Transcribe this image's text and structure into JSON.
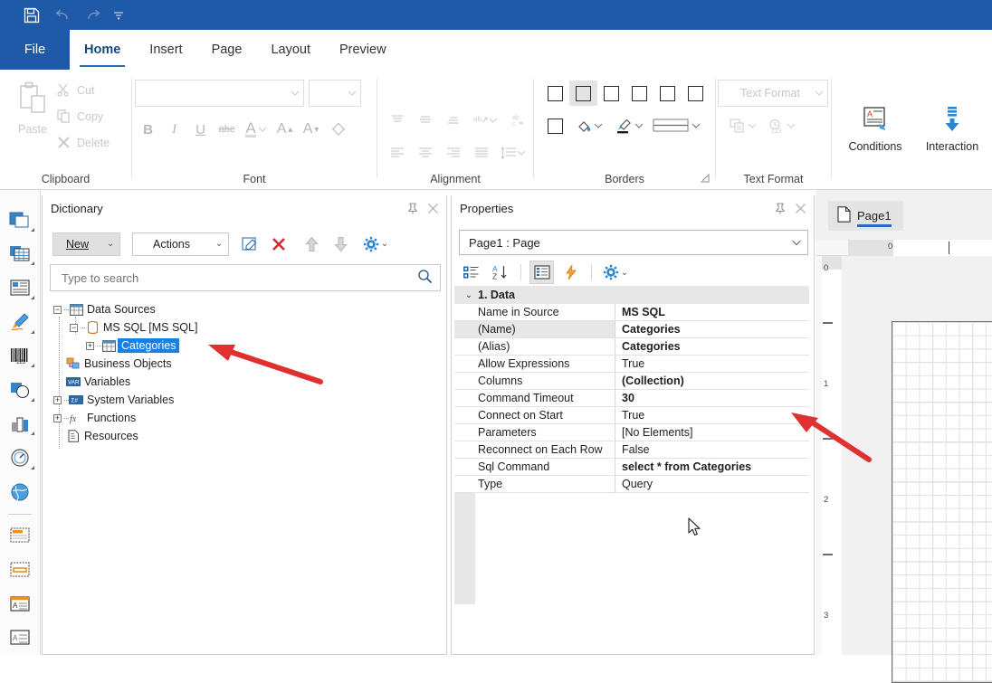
{
  "titlebar": {
    "buttons": [
      {
        "name": "save-icon",
        "label": "Save"
      },
      {
        "name": "undo-icon",
        "label": "Undo"
      },
      {
        "name": "redo-icon",
        "label": "Redo"
      },
      {
        "name": "customize-quick-access-icon",
        "label": "Customize Quick Access Toolbar"
      }
    ],
    "accent_color": "#1f5aa8"
  },
  "ribbon": {
    "file_tab": "File",
    "tabs": [
      {
        "label": "Home",
        "active": true
      },
      {
        "label": "Insert",
        "active": false
      },
      {
        "label": "Page",
        "active": false
      },
      {
        "label": "Layout",
        "active": false
      },
      {
        "label": "Preview",
        "active": false
      }
    ],
    "groups": {
      "clipboard": {
        "label": "Clipboard",
        "paste": "Paste",
        "cut": "Cut",
        "copy": "Copy",
        "delete": "Delete"
      },
      "font": {
        "label": "Font",
        "font_name_value": "",
        "font_size_value": "",
        "bold": "B",
        "italic": "I",
        "underline": "U",
        "strikeout": "abc",
        "font_color": "A",
        "grow_font": "A",
        "shrink_font": "A",
        "clear_format": "clear-format-icon"
      },
      "alignment": {
        "label": "Alignment"
      },
      "borders": {
        "label": "Borders"
      },
      "text_format": {
        "label": "Text Format",
        "combo_value": "Text Format"
      },
      "tools": {
        "conditions": "Conditions",
        "interaction": "Interaction"
      }
    }
  },
  "dictionary": {
    "title": "Dictionary",
    "toolbar": {
      "new": "New",
      "actions": "Actions",
      "edit": "edit-icon",
      "delete": "delete-icon",
      "move_up": "arrow-up-icon",
      "move_down": "arrow-down-icon",
      "settings": "gear-icon"
    },
    "search_placeholder": "Type to search",
    "search_value": "",
    "tree": [
      {
        "label": "Data Sources",
        "icon": "table-icon",
        "expanded": true,
        "level": 0
      },
      {
        "label": "MS SQL [MS SQL]",
        "icon": "database-icon",
        "expanded": true,
        "level": 1
      },
      {
        "label": "Categories",
        "icon": "table-icon",
        "expanded": false,
        "level": 2,
        "selected": true
      },
      {
        "label": "Business Objects",
        "icon": "business-objects-icon",
        "level": 0
      },
      {
        "label": "Variables",
        "icon": "variable-icon",
        "level": 0
      },
      {
        "label": "System Variables",
        "icon": "system-variable-icon",
        "expandable": true,
        "level": 0
      },
      {
        "label": "Functions",
        "icon": "function-icon",
        "expandable": true,
        "level": 0
      },
      {
        "label": "Resources",
        "icon": "resource-icon",
        "level": 0
      }
    ]
  },
  "properties": {
    "title": "Properties",
    "object_selector_value": "Page1 : Page",
    "toolbar": {
      "categorized": "categorized-view-icon",
      "alphabetical": "sort-alphabetical-icon",
      "properties": "properties-view-icon",
      "events": "events-lightning-icon",
      "settings": "gear-icon"
    },
    "category": "1. Data",
    "rows": [
      {
        "name": "Name in Source",
        "value": "MS SQL",
        "bold": true,
        "highlight": false
      },
      {
        "name": "(Name)",
        "value": "Categories",
        "bold": true,
        "highlight": true
      },
      {
        "name": "(Alias)",
        "value": "Categories",
        "bold": true,
        "highlight": false
      },
      {
        "name": "Allow Expressions",
        "value": "True",
        "bold": false,
        "highlight": false
      },
      {
        "name": "Columns",
        "value": "(Collection)",
        "bold": true,
        "highlight": false
      },
      {
        "name": "Command Timeout",
        "value": "30",
        "bold": true,
        "highlight": false
      },
      {
        "name": "Connect on Start",
        "value": "True",
        "bold": false,
        "highlight": false
      },
      {
        "name": "Parameters",
        "value": "[No Elements]",
        "bold": false,
        "highlight": false
      },
      {
        "name": "Reconnect on Each Row",
        "value": "False",
        "bold": false,
        "highlight": false
      },
      {
        "name": "Sql Command",
        "value": "select * from Categories",
        "bold": true,
        "highlight": false
      },
      {
        "name": "Type",
        "value": "Query",
        "bold": false,
        "highlight": false
      }
    ]
  },
  "document": {
    "tab_label": "Page1",
    "tab_icon": "page-icon",
    "horizontal_ruler_ticks": [
      "0"
    ],
    "vertical_ruler_ticks": [
      "0",
      "1",
      "2",
      "3"
    ]
  },
  "annotations": {
    "arrow_color": "#e03131",
    "arrows": [
      {
        "name": "arrow-pointing-to-categories"
      },
      {
        "name": "arrow-pointing-to-properties"
      }
    ]
  },
  "left_rail": {
    "items": [
      {
        "name": "panel-icon"
      },
      {
        "name": "data-band-icon"
      },
      {
        "name": "cross-tab-icon"
      },
      {
        "name": "pen-draw-icon"
      },
      {
        "name": "barcode-icon"
      },
      {
        "name": "shape-icon"
      },
      {
        "name": "chart-icon"
      },
      {
        "name": "gauge-icon"
      },
      {
        "name": "map-icon"
      },
      {
        "name": "report-title-band-icon"
      },
      {
        "name": "page-header-band-icon"
      },
      {
        "name": "header-band-icon"
      },
      {
        "name": "data-band-2-icon"
      }
    ]
  }
}
